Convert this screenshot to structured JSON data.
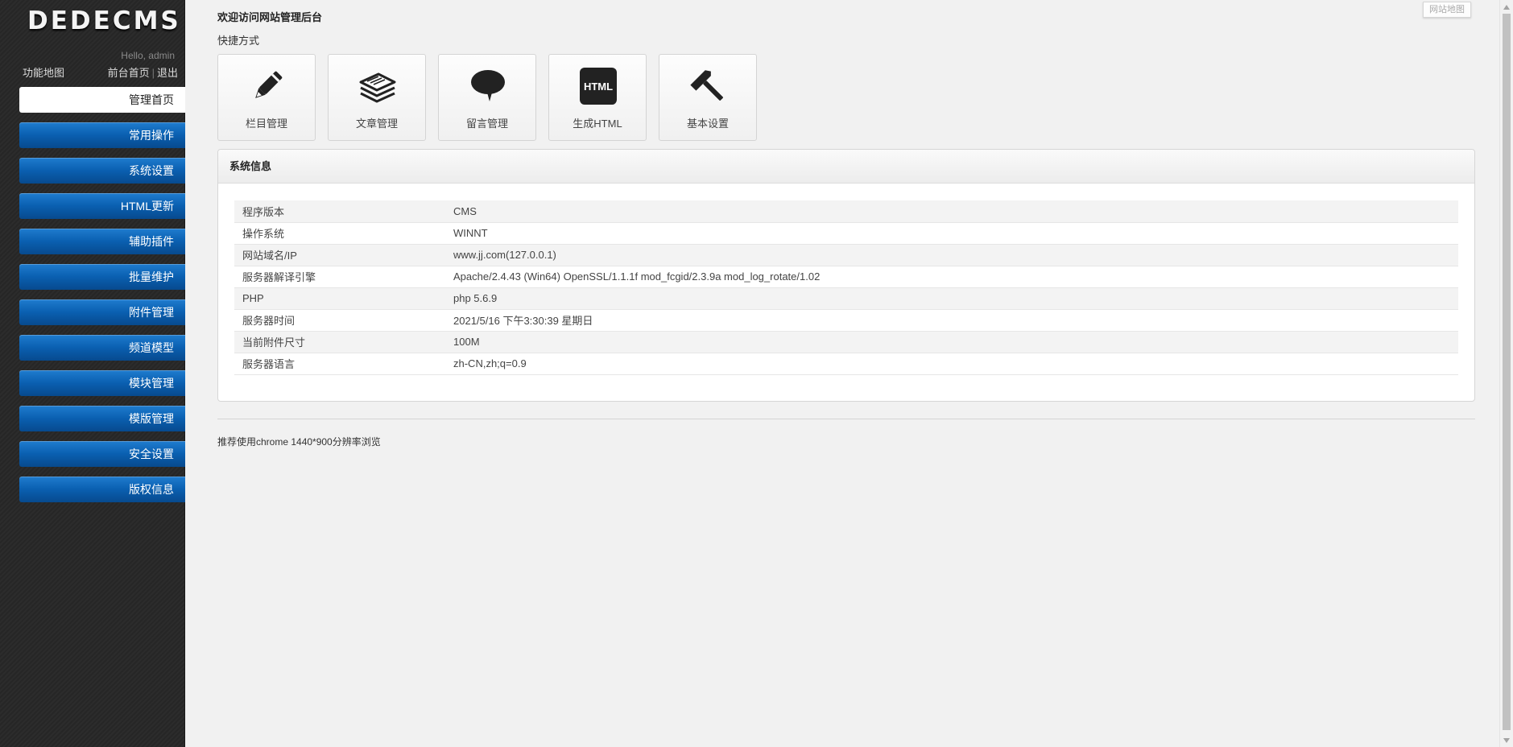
{
  "sidebar": {
    "logo": "DEDECMS",
    "hello": "Hello, admin",
    "map_link": "功能地图",
    "home_link": "前台首页",
    "separator": "|",
    "logout_link": "退出",
    "items": [
      {
        "label": "管理首页"
      },
      {
        "label": "常用操作"
      },
      {
        "label": "系统设置"
      },
      {
        "label": "HTML更新"
      },
      {
        "label": "辅助插件"
      },
      {
        "label": "批量维护"
      },
      {
        "label": "附件管理"
      },
      {
        "label": "频道模型"
      },
      {
        "label": "模块管理"
      },
      {
        "label": "模版管理"
      },
      {
        "label": "安全设置"
      },
      {
        "label": "版权信息"
      }
    ],
    "active_color": "#ffffff",
    "item_color": "#0a5fb0"
  },
  "main": {
    "welcome": "欢迎访问网站管理后台",
    "shortcut_title": "快捷方式",
    "shortcuts": [
      {
        "label": "栏目管理",
        "icon": "pencil-icon"
      },
      {
        "label": "文章管理",
        "icon": "papers-stack-icon"
      },
      {
        "label": "留言管理",
        "icon": "speech-bubble-icon"
      },
      {
        "label": "生成HTML",
        "icon": "html-icon",
        "icon_text": "HTML"
      },
      {
        "label": "基本设置",
        "icon": "hammer-icon"
      }
    ],
    "panel": {
      "title": "系统信息",
      "rows": [
        {
          "key": "程序版本",
          "value": "CMS"
        },
        {
          "key": "操作系统",
          "value": "WINNT"
        },
        {
          "key": "网站域名/IP",
          "value": "www.jj.com(127.0.0.1)"
        },
        {
          "key": "服务器解译引擎",
          "value": "Apache/2.4.43 (Win64) OpenSSL/1.1.1f mod_fcgid/2.3.9a mod_log_rotate/1.02"
        },
        {
          "key": "PHP",
          "value": "php 5.6.9"
        },
        {
          "key": "服务器时间",
          "value": "2021/5/16 下午3:30:39 星期日"
        },
        {
          "key": "当前附件尺寸",
          "value": "100M"
        },
        {
          "key": "服务器语言",
          "value": "zh-CN,zh;q=0.9"
        }
      ]
    },
    "footer": "推荐使用chrome 1440*900分辨率浏览"
  },
  "corner_tag": "网站地图"
}
